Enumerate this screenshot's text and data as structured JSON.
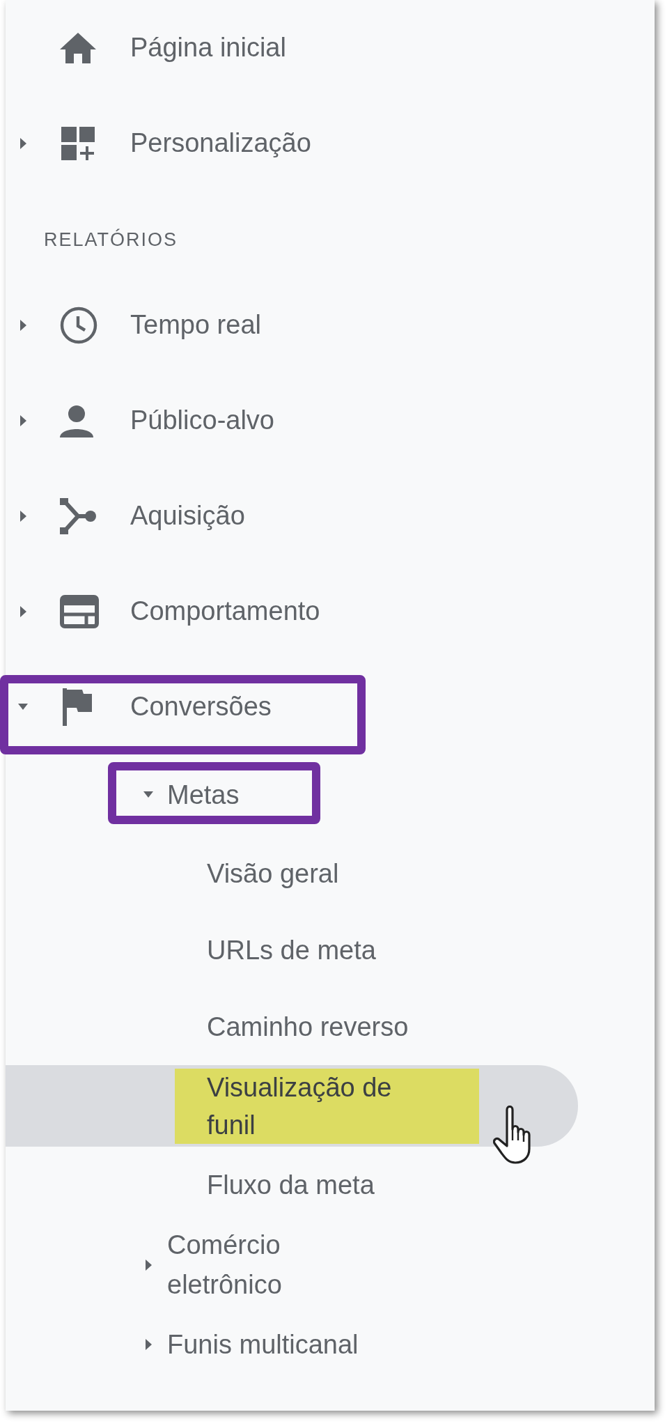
{
  "nav": {
    "items": [
      {
        "label": "Página inicial",
        "kind": "leaf",
        "outlined": false
      },
      {
        "label": "Personalização",
        "kind": "group",
        "expanded": false,
        "outlined": false
      }
    ],
    "section_title": "RELATÓRIOS",
    "reports": [
      {
        "label": "Tempo real",
        "kind": "group",
        "expanded": false,
        "outlined": false
      },
      {
        "label": "Público-alvo",
        "kind": "group",
        "expanded": false,
        "outlined": false
      },
      {
        "label": "Aquisição",
        "kind": "group",
        "expanded": false,
        "outlined": false
      },
      {
        "label": "Comportamento",
        "kind": "group",
        "expanded": false,
        "outlined": false
      },
      {
        "label": "Conversões",
        "kind": "group",
        "expanded": true,
        "outlined": true,
        "children": [
          {
            "label": "Metas",
            "expanded": true,
            "outlined": true,
            "children": [
              {
                "label": "Visão geral",
                "selected": false,
                "highlighted": false
              },
              {
                "label": "URLs de meta",
                "selected": false,
                "highlighted": false
              },
              {
                "label": "Caminho reverso",
                "selected": false,
                "highlighted": false
              },
              {
                "label": "Visualização de funil",
                "selected": true,
                "highlighted": true
              },
              {
                "label": "Fluxo da meta",
                "selected": false,
                "highlighted": false
              }
            ]
          },
          {
            "label": "Comércio eletrônico",
            "expanded": false,
            "outlined": false
          },
          {
            "label": "Funis multicanal",
            "expanded": false,
            "outlined": false
          }
        ]
      }
    ]
  }
}
